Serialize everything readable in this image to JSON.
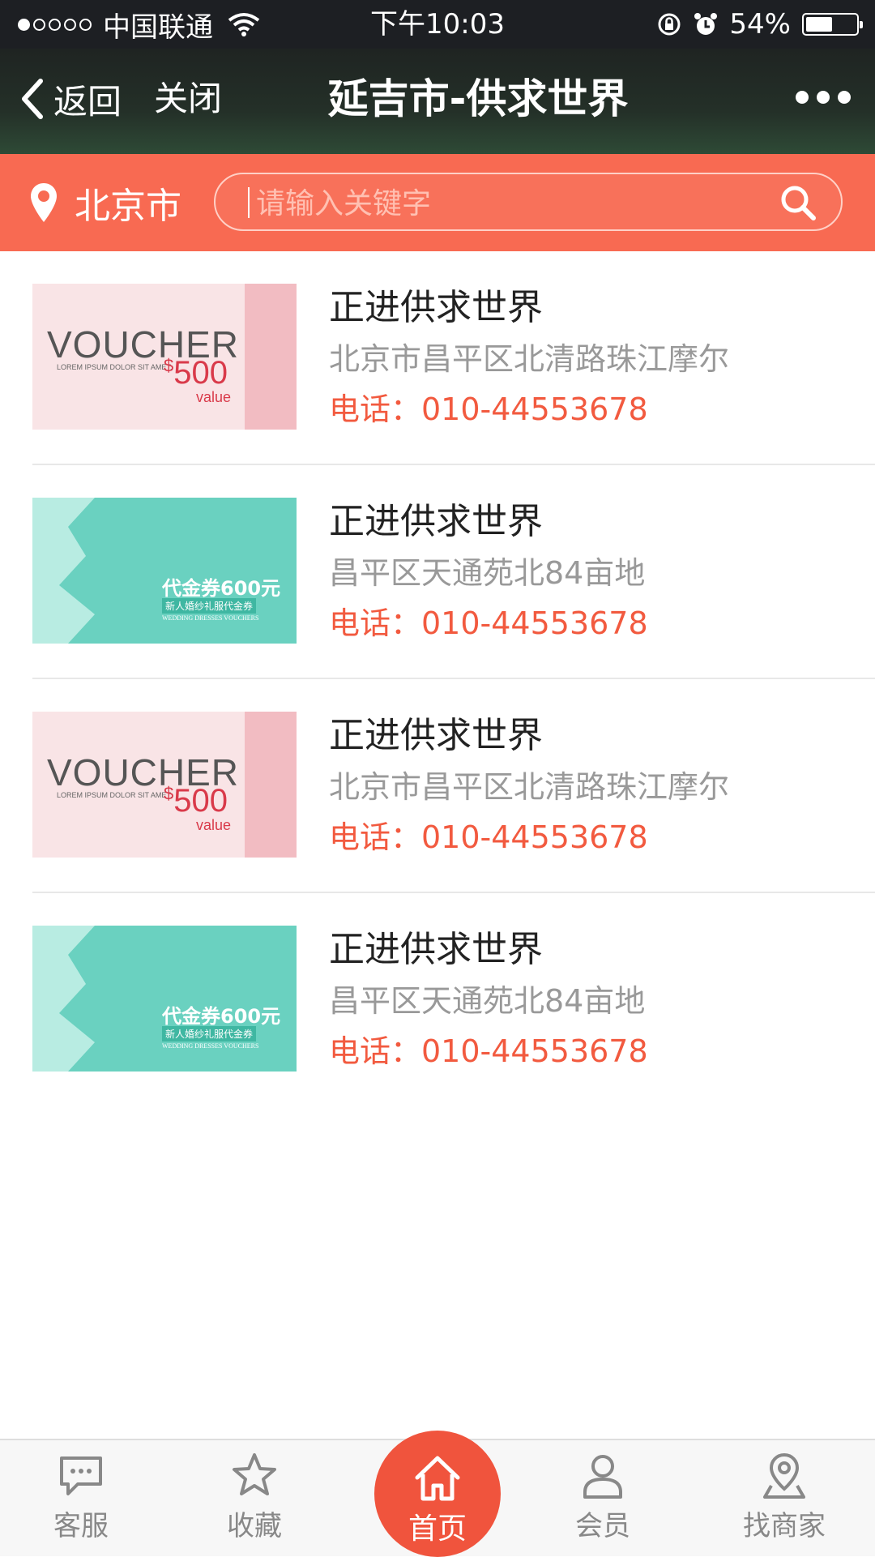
{
  "status_bar": {
    "carrier": "中国联通",
    "time": "下午10:03",
    "battery_percent_label": "54%",
    "battery_level": 0.54
  },
  "nav": {
    "back_label": "返回",
    "close_label": "关闭",
    "title": "延吉市-供求世界"
  },
  "search": {
    "city": "北京市",
    "placeholder": "请输入关键字"
  },
  "listings": [
    {
      "thumb": "voucher-pink",
      "name": "正进供求世界",
      "address": "北京市昌平区北清路珠江摩尔",
      "phone": "电话：010-44553678"
    },
    {
      "thumb": "voucher-teal",
      "name": "正进供求世界",
      "address": "昌平区天通苑北84亩地",
      "phone": "电话：010-44553678"
    },
    {
      "thumb": "voucher-pink",
      "name": "正进供求世界",
      "address": "北京市昌平区北清路珠江摩尔",
      "phone": "电话：010-44553678"
    },
    {
      "thumb": "voucher-teal",
      "name": "正进供求世界",
      "address": "昌平区天通苑北84亩地",
      "phone": "电话：010-44553678"
    }
  ],
  "vouchers": {
    "pink": {
      "word": "VOUCHER",
      "lorem": "LOREM IPSUM DOLOR SIT AMET,",
      "currency": "$",
      "amount": "500",
      "value": "value"
    },
    "teal": {
      "title": "代金券600元",
      "subtitle": "新人婚纱礼服代金券",
      "english": "WEDDING DRESSES VOUCHERS"
    }
  },
  "tabs": {
    "service": "客服",
    "favorites": "收藏",
    "home": "首页",
    "member": "会员",
    "find_merchant": "找商家"
  },
  "colors": {
    "accent": "#f86a52",
    "phone": "#f25a3f",
    "home_tab": "#f0543d"
  }
}
